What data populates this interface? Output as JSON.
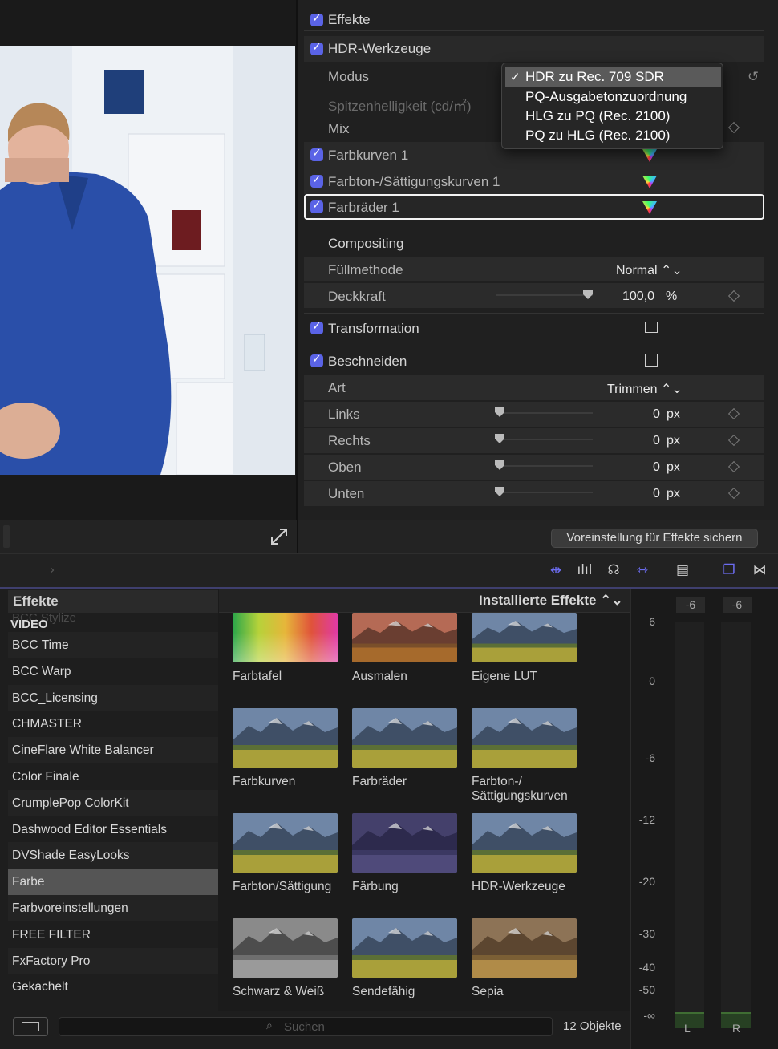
{
  "inspector": {
    "effekte_label": "Effekte",
    "hdr_label": "HDR-Werkzeuge",
    "modus_label": "Modus",
    "spitzen_label": "Spitzenhelligkeit (cd/㎡)",
    "mix_label": "Mix",
    "farbkurven_label": "Farbkurven 1",
    "farbton_label": "Farbton-/Sättigungskurven 1",
    "farbraeder_label": "Farbräder 1",
    "compositing_label": "Compositing",
    "fuellmethode_label": "Füllmethode",
    "fuellmethode_value": "Normal ⌃⌄",
    "deckkraft_label": "Deckkraft",
    "deckkraft_value": "100,0",
    "deckkraft_unit": "%",
    "transformation_label": "Transformation",
    "beschneiden_label": "Beschneiden",
    "art_label": "Art",
    "art_value": "Trimmen ⌃⌄",
    "crop": [
      {
        "label": "Links",
        "value": "0",
        "unit": "px"
      },
      {
        "label": "Rechts",
        "value": "0",
        "unit": "px"
      },
      {
        "label": "Oben",
        "value": "0",
        "unit": "px"
      },
      {
        "label": "Unten",
        "value": "0",
        "unit": "px"
      }
    ],
    "save_preset": "Voreinstellung für Effekte sichern"
  },
  "dropdown": {
    "items": [
      "HDR zu Rec. 709 SDR",
      "PQ-Ausgabetonzuordnung",
      "HLG zu PQ (Rec. 2100)",
      "PQ zu HLG (Rec. 2100)"
    ],
    "selected_index": 0
  },
  "browser": {
    "sidebar_title": "Effekte",
    "section": "VIDEO",
    "faded_item": "BCC Stylize",
    "items": [
      "BCC Time",
      "BCC Warp",
      "BCC_Licensing",
      "CHMASTER",
      "CineFlare White Balancer",
      "Color Finale",
      "CrumplePop ColorKit",
      "Dashwood Editor Essentials",
      "DVShade EasyLooks",
      "Farbe",
      "Farbvoreinstellungen",
      "FREE FILTER",
      "FxFactory Pro",
      "Gekachelt"
    ],
    "selected_item": "Farbe",
    "grid_title": "Installierte Effekte ⌃⌄",
    "effects": [
      {
        "name": "Farbtafel",
        "style": "rainbow"
      },
      {
        "name": "Ausmalen",
        "style": "warm"
      },
      {
        "name": "Eigene LUT",
        "style": "normal"
      },
      {
        "name": "Farbkurven",
        "style": "normal"
      },
      {
        "name": "Farbräder",
        "style": "normal"
      },
      {
        "name": "Farbton-/\nSättigungskurven",
        "style": "normal"
      },
      {
        "name": "Farbton/Sättigung",
        "style": "normal"
      },
      {
        "name": "Färbung",
        "style": "purple"
      },
      {
        "name": "HDR-Werkzeuge",
        "style": "normal"
      },
      {
        "name": "Schwarz & Weiß",
        "style": "bw"
      },
      {
        "name": "Sendefähig",
        "style": "normal"
      },
      {
        "name": "Sepia",
        "style": "sepia"
      }
    ],
    "search_placeholder": "Suchen",
    "count": "12 Objekte"
  },
  "meters": {
    "peak_left": "-6",
    "peak_right": "-6",
    "scale": [
      "6",
      "0",
      "-6",
      "-12",
      "-20",
      "-30",
      "-40",
      "-50",
      "-∞"
    ],
    "channels": [
      "L",
      "R"
    ]
  },
  "colors": {
    "accent": "#5a63e6",
    "meter_green": "#3f6d33"
  }
}
